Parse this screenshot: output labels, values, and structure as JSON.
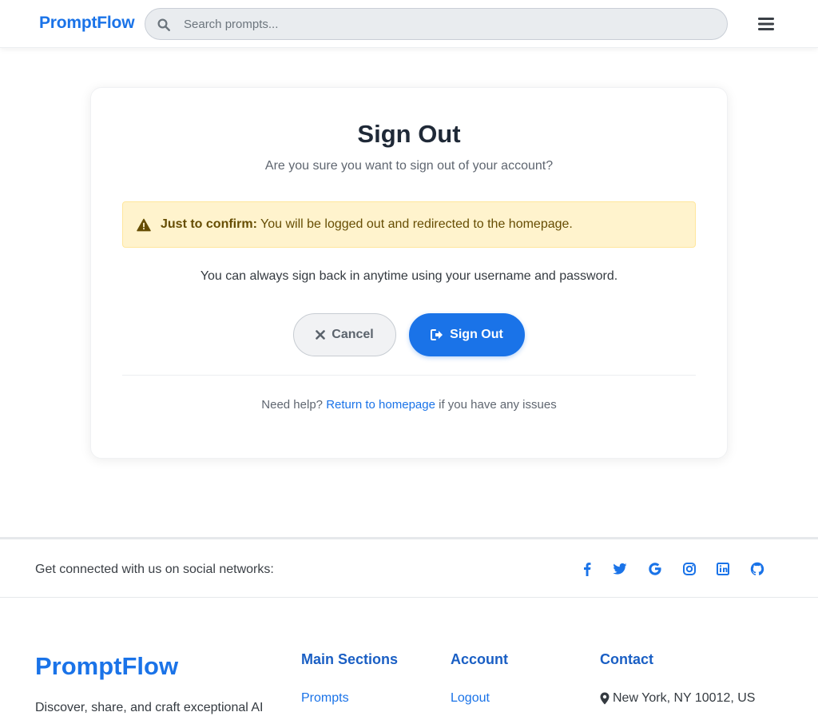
{
  "header": {
    "brand": "PromptFlow",
    "search_placeholder": "Search prompts..."
  },
  "signout": {
    "title": "Sign Out",
    "subtitle": "Are you sure you want to sign out of your account?",
    "alert_strong": "Just to confirm:",
    "alert_text": " You will be logged out and redirected to the homepage.",
    "info": "You can always sign back in anytime using your username and password.",
    "cancel_label": "Cancel",
    "signout_label": "Sign Out",
    "help_prefix": "Need help? ",
    "help_link": "Return to homepage",
    "help_suffix": " if you have any issues"
  },
  "social": {
    "text": "Get connected with us on social networks:",
    "icons": [
      "facebook-icon",
      "twitter-icon",
      "google-icon",
      "instagram-icon",
      "linkedin-icon",
      "github-icon"
    ]
  },
  "footer": {
    "brand": "PromptFlow",
    "description": "Discover, share, and craft exceptional AI",
    "main_sections_heading": "Main Sections",
    "main_sections_link": "Prompts",
    "account_heading": "Account",
    "account_link": "Logout",
    "contact_heading": "Contact",
    "contact_address": "New York, NY 10012, US"
  },
  "colors": {
    "primary": "#1a73e8",
    "alert_bg": "#fff3cd",
    "alert_text": "#664d03"
  }
}
